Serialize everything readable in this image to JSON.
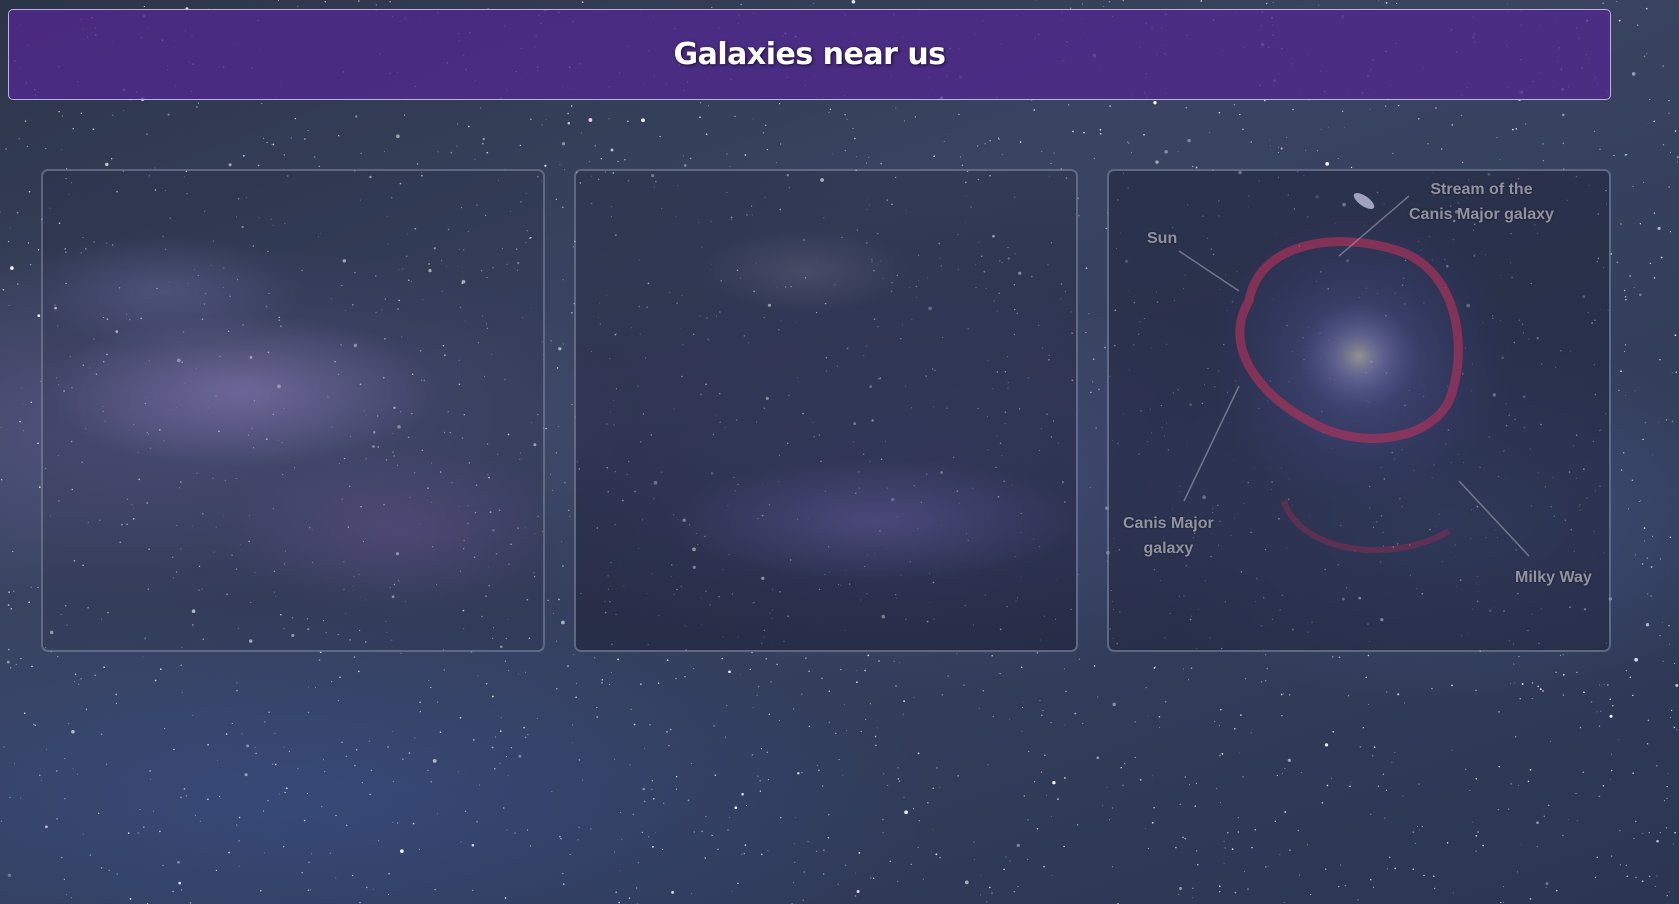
{
  "header": {
    "title": "Galaxies near us"
  },
  "cards": [
    {
      "name": "milky-way-image-1"
    },
    {
      "name": "milky-way-image-2"
    },
    {
      "name": "canis-major-diagram",
      "labels": {
        "stream_line1": "Stream of the",
        "stream_line2": "Canis Major galaxy",
        "sun": "Sun",
        "canis_line1": "Canis Major",
        "canis_line2": "galaxy",
        "milky_way": "Milky Way"
      }
    }
  ],
  "colors": {
    "banner": "#4f288c",
    "banner_border": "#d2c8f0",
    "background": "#343f5c",
    "ring": "#c8325a"
  }
}
